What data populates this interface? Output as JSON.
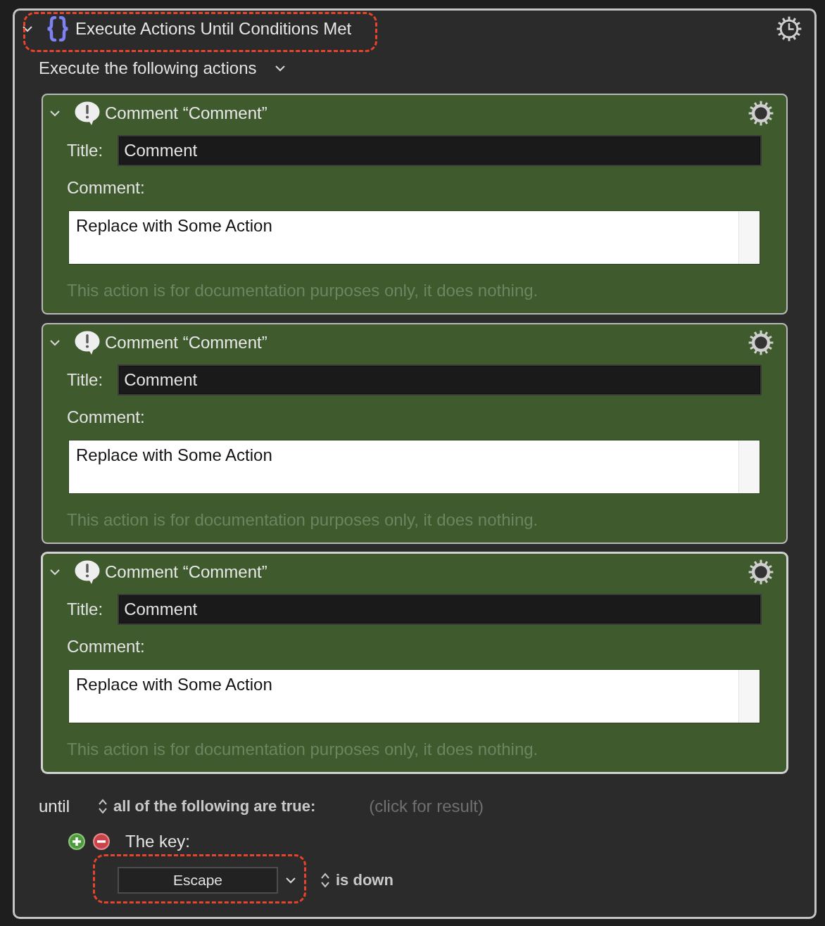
{
  "macro_action": {
    "title": "Execute Actions Until Conditions Met",
    "expanded": true,
    "highlighted": true
  },
  "section_menu": "Execute the following actions",
  "actions": [
    {
      "heading": "Comment “Comment”",
      "expanded": true,
      "selected": false,
      "title_label": "Title:",
      "title_value": "Comment",
      "comment_label": "Comment:",
      "comment_value": "Replace with Some Action",
      "note": "This action is for documentation purposes only, it does nothing."
    },
    {
      "heading": "Comment “Comment”",
      "expanded": true,
      "selected": false,
      "title_label": "Title:",
      "title_value": "Comment",
      "comment_label": "Comment:",
      "comment_value": "Replace with Some Action",
      "note": "This action is for documentation purposes only, it does nothing."
    },
    {
      "heading": "Comment “Comment”",
      "expanded": true,
      "selected": true,
      "title_label": "Title:",
      "title_value": "Comment",
      "comment_label": "Comment:",
      "comment_value": "Replace with Some Action",
      "note": "This action is for documentation purposes only, it does nothing."
    }
  ],
  "until": {
    "label": "until",
    "match": "all of the following are true:",
    "result_hint": "(click for result)"
  },
  "conditions": [
    {
      "label": "The key:",
      "key": "Escape",
      "highlighted": true,
      "state": "is down"
    }
  ]
}
